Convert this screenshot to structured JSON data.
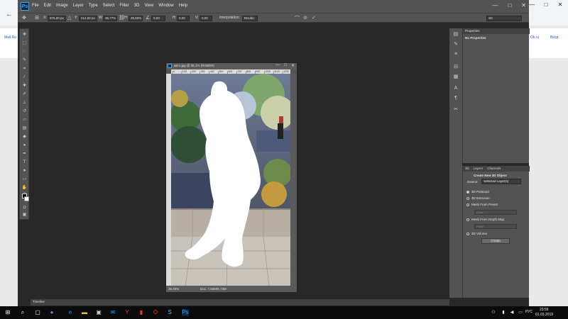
{
  "browser": {
    "links_left": [
      "Mail.Ru"
    ],
    "links_right": [
      "Ok.ru",
      "Вход"
    ],
    "nav_back": "←"
  },
  "app": {
    "logo": "Ps",
    "menu": [
      "File",
      "Edit",
      "Image",
      "Layer",
      "Type",
      "Select",
      "Filter",
      "3D",
      "View",
      "Window",
      "Help"
    ],
    "win_controls": [
      "—",
      "□",
      "✕"
    ]
  },
  "options_bar": {
    "x_label": "X:",
    "x_value": "976,00 px",
    "y_label": "Y:",
    "y_value": "614,50 px",
    "w_label": "W:",
    "w_value": "36,77%",
    "h_label": "H:",
    "h_value": "35,55%",
    "angle_value": "0,00",
    "hskew_label": "H:",
    "hskew_value": "0,00",
    "vskew_label": "V:",
    "vskew_value": "0,00",
    "interp_label": "Interpolation:",
    "interp_value": "Bicubic",
    "workspace_value": "3D"
  },
  "document": {
    "title": "автo.jpg @ 35,1% (RGB/8#)",
    "controls": [
      "—",
      "□",
      "✕"
    ],
    "ruler_marks": [
      "0",
      "100",
      "200",
      "300",
      "400",
      "500",
      "600",
      "700",
      "800",
      "900",
      "1000",
      "1100",
      "1200"
    ],
    "zoom": "35,33%",
    "doc_size": "Doc: 7,55M/6,74M"
  },
  "properties": {
    "tab": "Properties",
    "empty_text": "No Properties"
  },
  "panel_3d": {
    "tabs": [
      "3D",
      "Layers",
      "Channels"
    ],
    "title": "Create New 3D Object",
    "source_label": "Source:",
    "source_value": "Selected Layer(s)",
    "options": [
      "3D Postcard",
      "3D Extrusion",
      "Mesh From Preset",
      "Mesh From Depth Map",
      "3D Volume"
    ],
    "preset_value": "Cone",
    "depthmap_value": "Plane",
    "create_label": "Create"
  },
  "timeline": {
    "label": "Timeline"
  },
  "taskbar": {
    "time": "23:56",
    "date": "01.03.2019",
    "lang": "РУС"
  }
}
